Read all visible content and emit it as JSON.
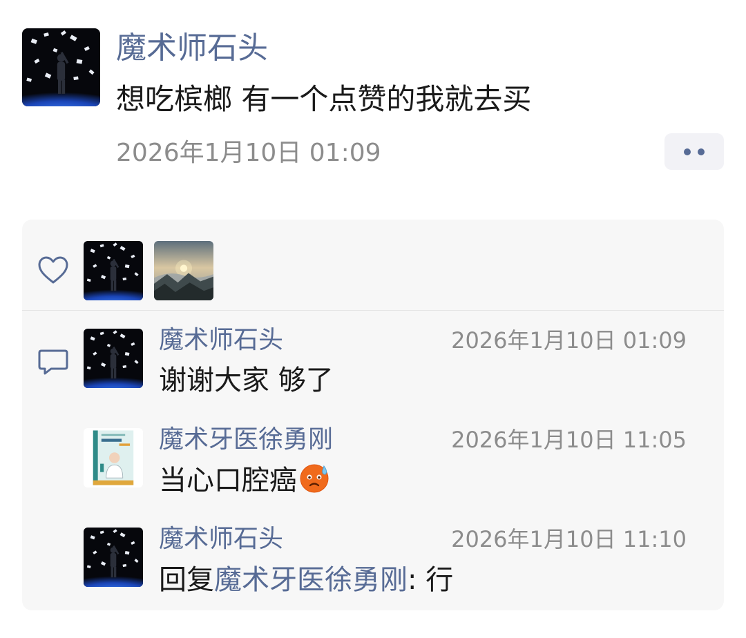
{
  "post": {
    "author": "魔术师石头",
    "text": "想吃槟榔 有一个点赞的我就去买",
    "time": "2026年1月10日 01:09"
  },
  "likes": {
    "icon": "heart-icon",
    "avatars": [
      "magician-avatar",
      "mountain-sunrise-avatar"
    ]
  },
  "comments": [
    {
      "author": "魔术师石头",
      "time": "2026年1月10日 01:09",
      "text": "谢谢大家 够了",
      "avatar": "magician-avatar"
    },
    {
      "author": "魔术牙医徐勇刚",
      "time": "2026年1月10日 11:05",
      "text": "当心口腔癌",
      "emoji": "sweat-emoji",
      "avatar": "book-cover-avatar"
    },
    {
      "author": "魔术师石头",
      "time": "2026年1月10日 11:10",
      "reply_prefix": "回复",
      "reply_to": "魔术牙医徐勇刚",
      "reply_sep": ": ",
      "text": "行",
      "avatar": "magician-avatar"
    }
  ],
  "colors": {
    "name_blue": "#576b95",
    "panel_bg": "#f7f7f7",
    "time_gray": "#8c8c8c"
  }
}
